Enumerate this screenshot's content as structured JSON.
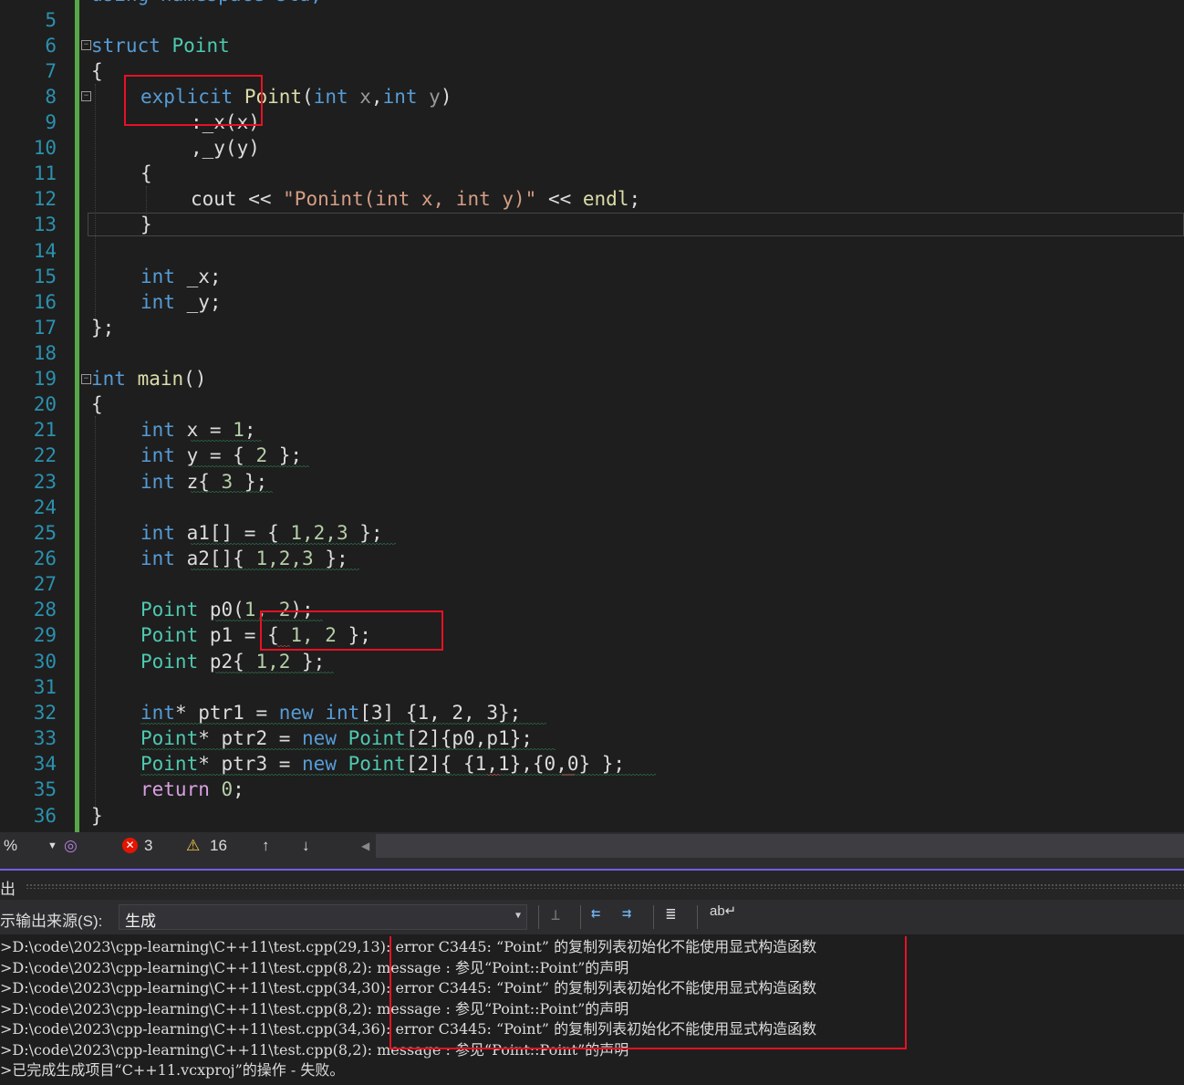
{
  "editor": {
    "line_numbers": [
      "5",
      "6",
      "7",
      "8",
      "9",
      "10",
      "11",
      "12",
      "13",
      "14",
      "15",
      "16",
      "17",
      "18",
      "19",
      "20",
      "21",
      "22",
      "23",
      "24",
      "25",
      "26",
      "27",
      "28",
      "29",
      "30",
      "31",
      "32",
      "33",
      "34",
      "35",
      "36"
    ],
    "top_partial": "using namespace std;",
    "lines": {
      "l6": {
        "kw": "struct",
        "name": "Point"
      },
      "l7": "{",
      "l8": {
        "kw": "explicit",
        "fn": "Point",
        "p1": "(",
        "t1": "int",
        "a1": " x",
        "c": ",",
        "t2": "int",
        "a2": " y",
        ")": ")"
      },
      "l9": ":_x(x)",
      "l10": ",_y(y)",
      "l11": "{",
      "l12": {
        "id": "cout",
        "op1": " << ",
        "str": "\"Ponint(int x, int y)\"",
        "op2": " << ",
        "fn": "endl",
        "semi": ";"
      },
      "l13": "}",
      "l15": {
        "t": "int",
        "v": " _x;"
      },
      "l16": {
        "t": "int",
        "v": " _y;"
      },
      "l17": "};",
      "l19": {
        "t": "int",
        "fn": " main",
        "rest": "()"
      },
      "l20": "{",
      "l21": {
        "t": "int",
        "v": " x = ",
        "n": "1",
        "e": ";"
      },
      "l22": {
        "t": "int",
        "v": " y = { ",
        "n": "2",
        "e": " };"
      },
      "l23": {
        "t": "int",
        "v": " z{ ",
        "n": "3",
        "e": " };"
      },
      "l25": {
        "t": "int",
        "v": " a1[] = { ",
        "n": "1,2,3",
        "e": " };"
      },
      "l26": {
        "t": "int",
        "v": " a2[]{ ",
        "n": "1,2,3",
        "e": " };"
      },
      "l28": {
        "t": "Point",
        "v": " p0(",
        "n": "1, 2",
        "e": ");"
      },
      "l29": {
        "t": "Point",
        "v": " p1 = { ",
        "n": "1, 2",
        "e": " };"
      },
      "l30": {
        "t": "Point",
        "v": " p2{ ",
        "n": "1,2",
        "e": " };"
      },
      "l32": {
        "t": "int",
        "s": "*",
        "v": " ptr1 = ",
        "k": "new",
        "t2": " int",
        "r": "[3] {1, 2, 3};"
      },
      "l33": {
        "t": "Point",
        "s": "*",
        "v": " ptr2 = ",
        "k": "new",
        "t2": " Point",
        "r": "[2]{p0,p1};"
      },
      "l34": {
        "t": "Point",
        "s": "*",
        "v": " ptr3 = ",
        "k": "new",
        "t2": " Point",
        "r": "[2]{ {1,1},{0,0} };"
      },
      "l35": {
        "k": "return",
        "n": " 0",
        "e": ";"
      },
      "l36": "}"
    }
  },
  "statusbar": {
    "zoom": "%",
    "errors": "3",
    "warnings": "16",
    "up_arrow": "↑",
    "down_arrow": "↓"
  },
  "output": {
    "title": "出",
    "source_label": "示输出来源(S):",
    "source_value": "生成",
    "lines": [
      ">D:\\code\\2023\\cpp-learning\\C++11\\test.cpp(29,13): error C3445: “Point” 的复制列表初始化不能使用显式构造函数",
      ">D:\\code\\2023\\cpp-learning\\C++11\\test.cpp(8,2): message : 参见“Point::Point”的声明",
      ">D:\\code\\2023\\cpp-learning\\C++11\\test.cpp(34,30): error C3445: “Point” 的复制列表初始化不能使用显式构造函数",
      ">D:\\code\\2023\\cpp-learning\\C++11\\test.cpp(8,2): message : 参见“Point::Point”的声明",
      ">D:\\code\\2023\\cpp-learning\\C++11\\test.cpp(34,36): error C3445: “Point” 的复制列表初始化不能使用显式构造函数",
      ">D:\\code\\2023\\cpp-learning\\C++11\\test.cpp(8,2): message : 参见“Point::Point”的声明",
      ">已完成生成项目“C++11.vcxproj”的操作 - 失败。"
    ]
  },
  "colors": {
    "keyword": "#569cd6",
    "type": "#4ec9b0",
    "string": "#d69d85",
    "highlight_box": "#e81123",
    "change_bar": "#57a64a"
  }
}
